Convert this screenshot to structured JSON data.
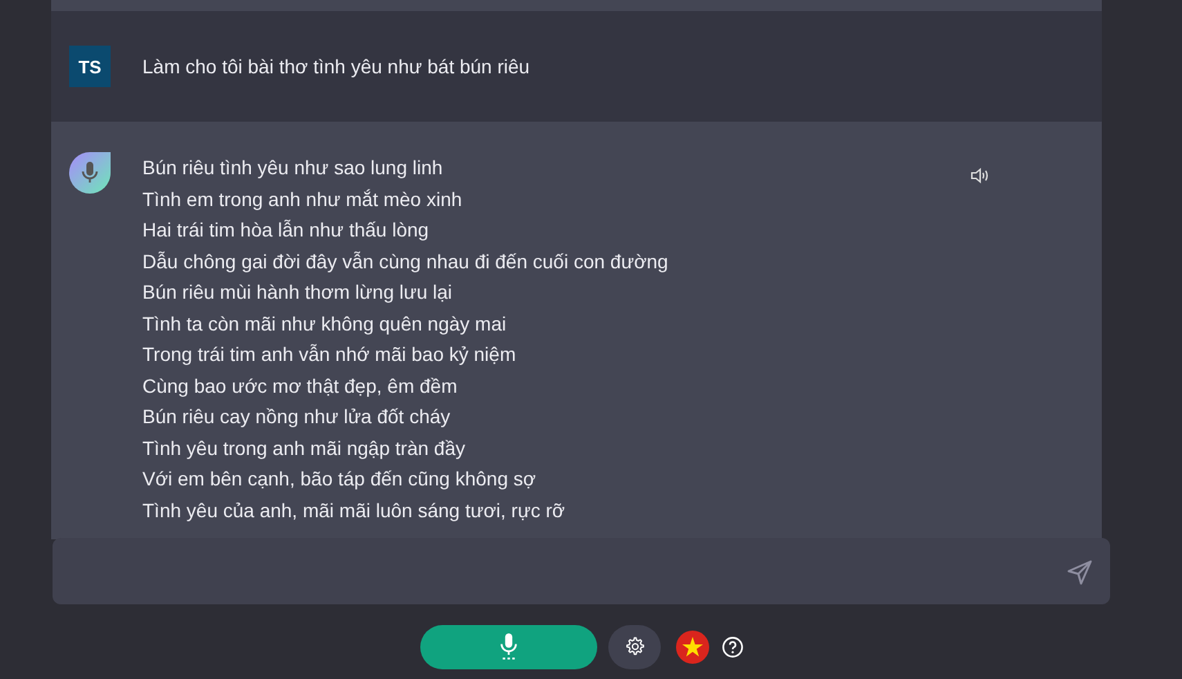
{
  "messages": [
    {
      "kind": "user",
      "avatar": "TS",
      "lines": [
        "Làm cho tôi bài thơ tình yêu như bát bún riêu"
      ]
    },
    {
      "kind": "assistant",
      "lines": [
        "Bún riêu tình yêu như sao lung linh",
        "Tình em trong anh như mắt mèo xinh",
        "Hai trái tim hòa lẫn như thấu lòng",
        "Dẫu chông gai đời đây vẫn cùng nhau đi đến cuối con đường",
        "Bún riêu mùi hành thơm lừng lưu lại",
        "Tình ta còn mãi như không quên ngày mai",
        "Trong trái tim anh vẫn nhớ mãi bao kỷ niệm",
        "Cùng bao ước mơ thật đẹp, êm đềm",
        "Bún riêu cay nồng như lửa đốt cháy",
        "Tình yêu trong anh mãi ngập tràn đầy",
        "Với em bên cạnh, bão táp đến cũng không sợ",
        "Tình yêu của anh, mãi mãi luôn sáng tươi, rực rỡ"
      ]
    }
  ]
}
